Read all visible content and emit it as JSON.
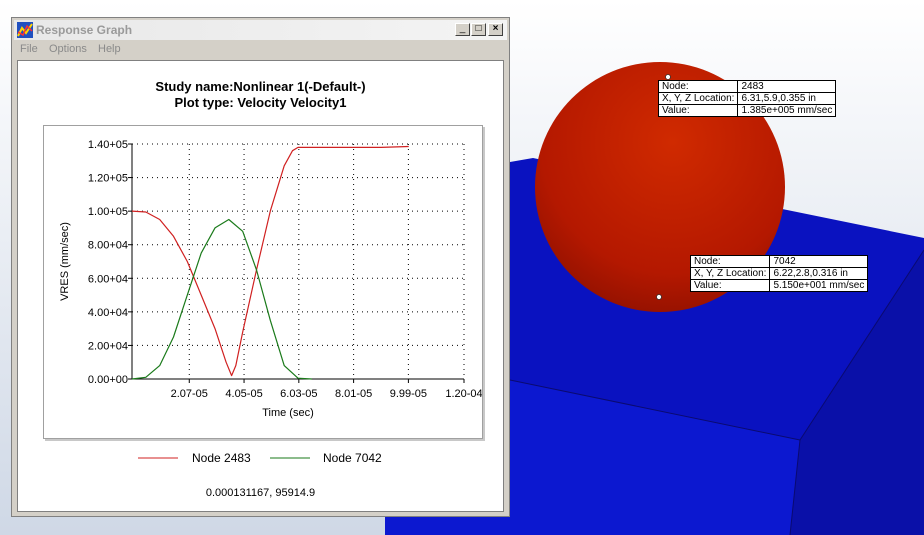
{
  "window": {
    "title": "Response Graph",
    "menu": [
      "File",
      "Options",
      "Help"
    ],
    "controls": [
      "_",
      "□",
      "×"
    ]
  },
  "chart_data": {
    "type": "line",
    "title": "Study name:Nonlinear 1(-Default-)",
    "subtitle": "Plot type: Velocity Velocity1",
    "xlabel": "Time (sec)",
    "ylabel": "VRES (mm/sec)",
    "xlim": [
      0,
      0.00012
    ],
    "ylim": [
      0,
      140000
    ],
    "x_ticks": [
      "2.07-05",
      "4.05-05",
      "6.03-05",
      "8.01-05",
      "9.99-05",
      "1.20-04"
    ],
    "x_tick_values": [
      2.07e-05,
      4.05e-05,
      6.03e-05,
      8.01e-05,
      9.99e-05,
      0.00012
    ],
    "y_ticks": [
      "0.00+00",
      "2.00+04",
      "4.00+04",
      "6.00+04",
      "8.00+04",
      "1.00+05",
      "1.20+05",
      "1.40+05"
    ],
    "y_tick_values": [
      0,
      20000,
      40000,
      60000,
      80000,
      100000,
      120000,
      140000
    ],
    "grid": true,
    "legend_position": "bottom",
    "series": [
      {
        "name": "Node 2483",
        "color": "#d02020",
        "x": [
          0,
          5e-06,
          1e-05,
          1.5e-05,
          2e-05,
          2.5e-05,
          3e-05,
          3.4e-05,
          3.6e-05,
          3.75e-05,
          4e-05,
          4.5e-05,
          5e-05,
          5.5e-05,
          5.8e-05,
          6e-05,
          7e-05,
          8e-05,
          9e-05,
          0.0001
        ],
        "y": [
          100000,
          99500,
          95000,
          85000,
          70000,
          50000,
          30000,
          10000,
          2000,
          8000,
          28000,
          65000,
          100000,
          127000,
          136000,
          138000,
          138000,
          138000,
          138000,
          138500
        ]
      },
      {
        "name": "Node 7042",
        "color": "#1a7a1a",
        "x": [
          0,
          5e-06,
          1e-05,
          1.5e-05,
          2e-05,
          2.5e-05,
          3e-05,
          3.5e-05,
          4e-05,
          4.5e-05,
          5e-05,
          5.5e-05,
          6e-05,
          6.5e-05
        ],
        "y": [
          0,
          1000,
          8000,
          25000,
          50000,
          75000,
          90000,
          95000,
          88000,
          65000,
          35000,
          8000,
          500,
          0
        ]
      }
    ]
  },
  "cursor_readout": "0.000131167, 95914.9",
  "probes": [
    {
      "node_label": "Node:",
      "node": "2483",
      "loc_label": "X, Y, Z Location:",
      "loc": "6.31,5.9,0.355 in",
      "val_label": "Value:",
      "val": "1.385e+005 mm/sec"
    },
    {
      "node_label": "Node:",
      "node": "7042",
      "loc_label": "X, Y, Z Location:",
      "loc": "6.22,2.8,0.316 in",
      "val_label": "Value:",
      "val": "5.150e+001 mm/sec"
    }
  ],
  "scene_colors": {
    "sphere": "#c41a00",
    "block": "#0a14c8",
    "background": "#e9edf3"
  }
}
